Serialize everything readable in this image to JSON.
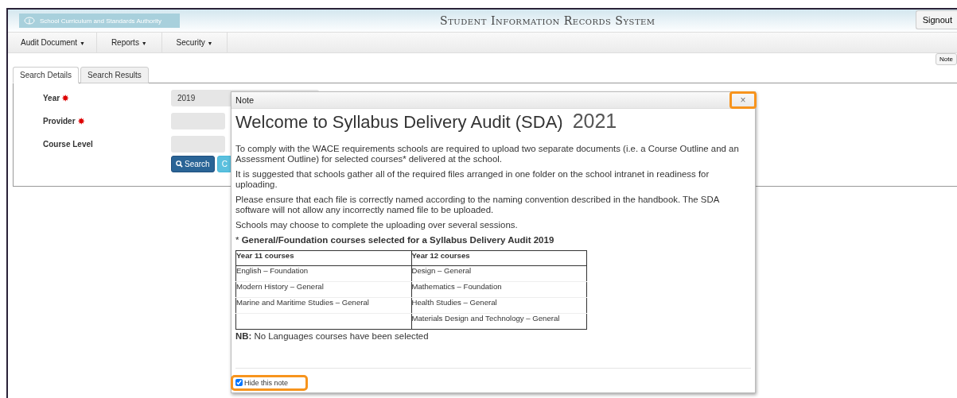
{
  "header": {
    "logo_text": "School Curriculum and Standards Authority",
    "title": "Student Information Records System",
    "signout": "Signout"
  },
  "menu": [
    {
      "label": "Audit Document",
      "caret": "▼"
    },
    {
      "label": "Reports",
      "caret": "▼"
    },
    {
      "label": "Security",
      "caret": "▼"
    }
  ],
  "note_button": "Note",
  "tabs": [
    {
      "label": "Search Details",
      "selected": true
    },
    {
      "label": "Search Results",
      "selected": false
    }
  ],
  "form": {
    "fields": [
      {
        "label": "Year",
        "required_mark": "✸",
        "value": "2019"
      },
      {
        "label": "Provider",
        "required_mark": "✸"
      },
      {
        "label": "Course Level"
      }
    ],
    "buttons": [
      {
        "kind": "primary",
        "label": "Search"
      },
      {
        "kind": "info",
        "label": "C"
      }
    ]
  },
  "dialog": {
    "title": "Note",
    "close": {
      "symbol": "×",
      "highlighted": true
    },
    "heading": "Welcome to Syllabus Delivery Audit (SDA)",
    "heading_year": "2021",
    "paragraphs": [
      "To comply with the WACE requirements schools are required to upload two separate documents (i.e. a Course Outline and an Assessment Outline) for selected courses* delivered at the school.",
      "It is suggested that schools gather all of the required files arranged in one folder on the school intranet in readiness for uploading.",
      "Please ensure that each file is correctly named according to the naming convention described in the handbook. The SDA software will not allow any incorrectly named file to be uploaded.",
      "Schools may choose to complete the uploading over several sessions."
    ],
    "table_caption": "* **General/Foundation courses selected for a Syllabus Delivery Audit 2019**",
    "table": {
      "columns": [
        "Year 11 courses",
        "Year 12 courses"
      ],
      "rows": [
        [
          "English – Foundation",
          "Design – General"
        ],
        [
          "Modern History – General",
          "Mathematics – Foundation"
        ],
        [
          "Marine and Maritime Studies – General",
          "Health Studies – General"
        ],
        [
          "",
          "Materials Design and Technology – General"
        ]
      ]
    },
    "note": "**NB:** No Languages courses have been selected",
    "hide_checkbox": {
      "label": "Hide this note",
      "checked": true,
      "highlighted": true
    }
  }
}
